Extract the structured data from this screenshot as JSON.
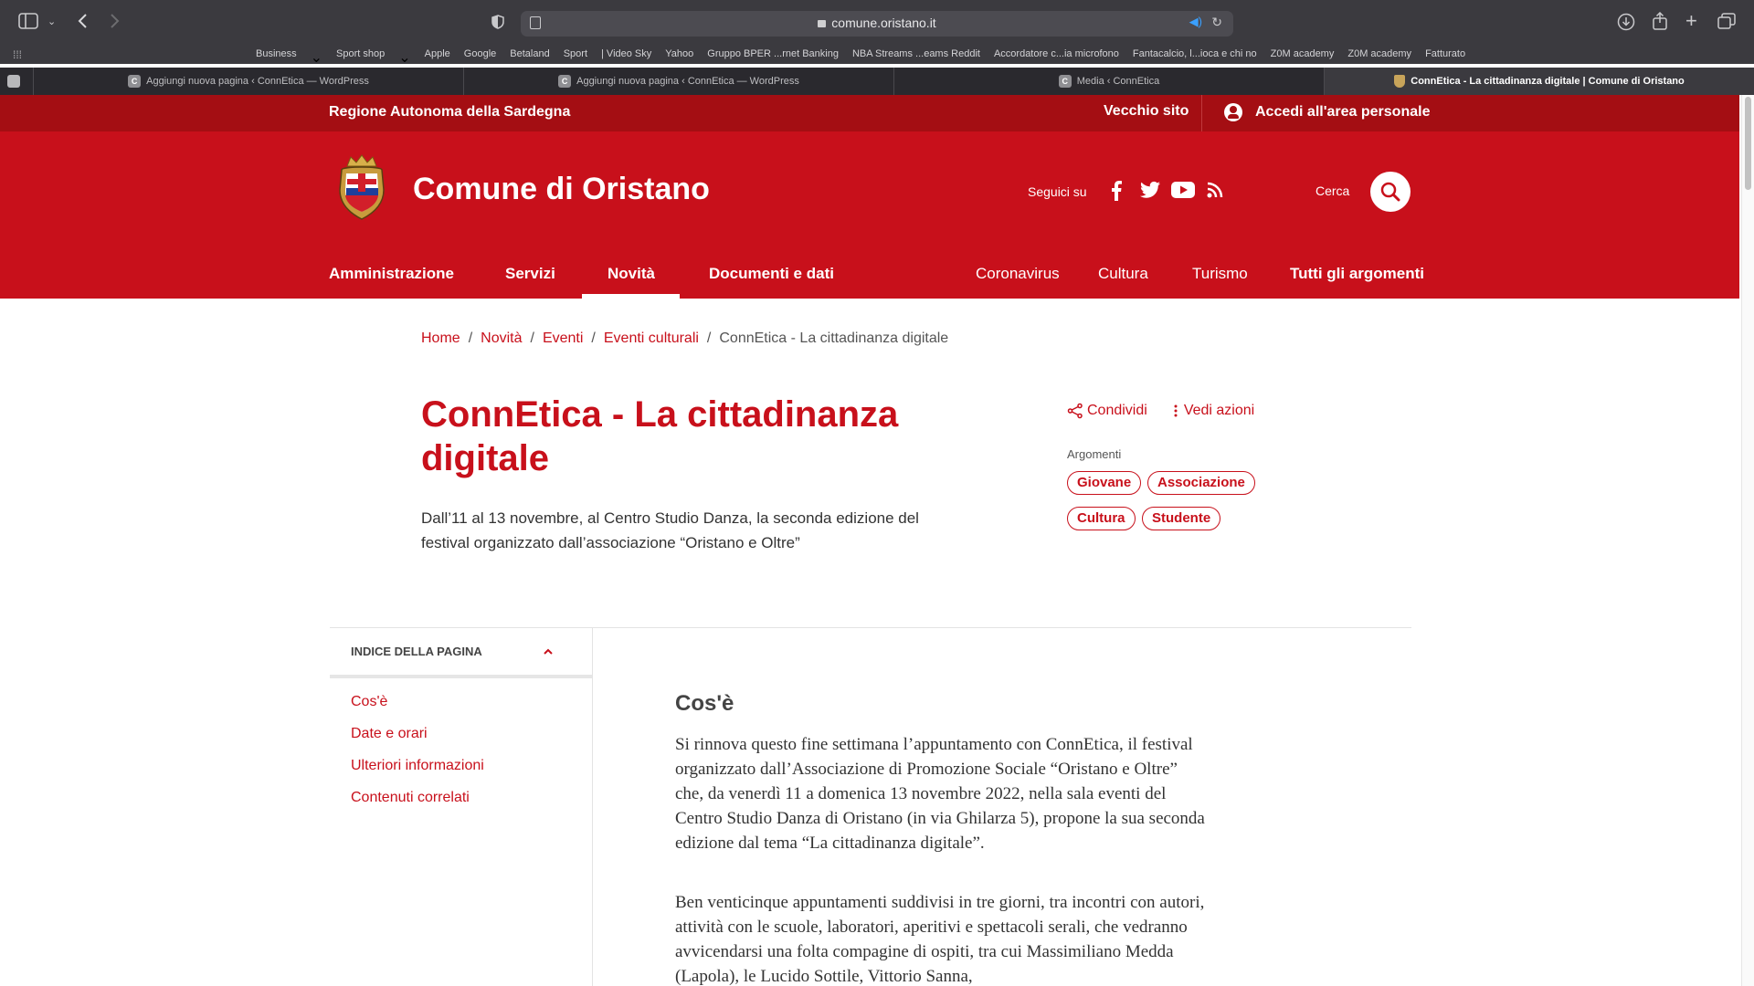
{
  "browser": {
    "url": "comune.oristano.it",
    "favorites": [
      "Business",
      "Sport shop",
      "Apple",
      "Google",
      "Betaland",
      "Sport",
      "| Video Sky",
      "Yahoo",
      "Gruppo BPER ...rnet Banking",
      "NBA Streams ...eams Reddit",
      "Accordatore c...ia microfono",
      "Fantacalcio, l...ioca e chi no",
      "Z0M academy",
      "Z0M academy",
      "Fatturato"
    ],
    "tabs": [
      {
        "label": "Aggiungi nuova pagina ‹ ConnEtica — WordPress",
        "favicon": "C"
      },
      {
        "label": "Aggiungi nuova pagina ‹ ConnEtica — WordPress",
        "favicon": "C"
      },
      {
        "label": "Media ‹ ConnEtica",
        "favicon": "C"
      },
      {
        "label": "ConnEtica - La cittadinanza digitale | Comune di Oristano",
        "favicon": "crest"
      }
    ]
  },
  "topbar": {
    "region": "Regione Autonoma della Sardegna",
    "old_site": "Vecchio sito",
    "login": "Accedi all'area personale"
  },
  "header": {
    "title": "Comune di Oristano",
    "follow": "Seguici su",
    "search_label": "Cerca"
  },
  "nav": {
    "left": [
      "Amministrazione",
      "Servizi",
      "Novità",
      "Documenti e dati"
    ],
    "right": [
      "Coronavirus",
      "Cultura",
      "Turismo",
      "Tutti gli argomenti"
    ],
    "active": "Novità"
  },
  "breadcrumb": [
    "Home",
    "Novità",
    "Eventi",
    "Eventi culturali",
    "ConnEtica - La cittadinanza digitale"
  ],
  "article": {
    "title": "ConnEtica - La cittadinanza digitale",
    "lead": "Dall’11 al 13 novembre, al Centro Studio Danza, la seconda edizione del festival organizzato dall’associazione “Oristano e Oltre”",
    "share": "Condividi",
    "actions": "Vedi azioni",
    "topics_label": "Argomenti",
    "topics": [
      "Giovane",
      "Associazione",
      "Cultura",
      "Studente"
    ]
  },
  "toc": {
    "title": "INDICE DELLA PAGINA",
    "items": [
      "Cos'è",
      "Date e orari",
      "Ulteriori informazioni",
      "Contenuti correlati"
    ]
  },
  "content": {
    "heading": "Cos'è",
    "p1": "Si rinnova questo fine settimana l’appuntamento con ConnEtica, il festival organizzato dall’Associazione di Promozione Sociale “Oristano e Oltre” che, da venerdì 11 a domenica 13 novembre 2022, nella sala eventi del Centro Studio Danza di Oristano (in via Ghilarza 5), propone la sua seconda edizione dal tema “La cittadinanza digitale”.",
    "p2": "Ben venticinque appuntamenti suddivisi in tre giorni, tra incontri con autori, attività con le scuole, laboratori, aperitivi e spettacoli serali, che vedranno avvicendarsi una folta compagine di ospiti, tra cui Massimiliano Medda (Lapola), le Lucido Sottile, Vittorio Sanna,"
  },
  "colors": {
    "brand_red": "#c8101b",
    "dark_red": "#a40e13",
    "chrome_bg": "#3b3a3f"
  }
}
